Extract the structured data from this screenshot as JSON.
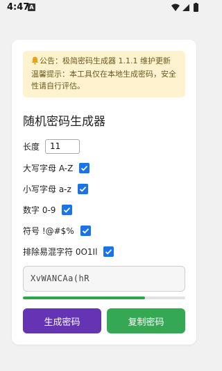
{
  "statusbar": {
    "time": "4:47",
    "app_badge": "A",
    "icons": [
      "wifi-icon",
      "cellular-icon",
      "battery-icon"
    ]
  },
  "notice": {
    "icon": "bell-icon",
    "text": "公告：极简密码生成器 1.1.1 维护更新 温馨提示：本工具仅在本地生成密码，安全性请自行评估。",
    "bg_color": "#fff3cf"
  },
  "generator": {
    "title": "随机密码生成器",
    "length_label": "长度",
    "length_value": "11",
    "options": [
      {
        "label": "大写字母 A-Z",
        "checked": true
      },
      {
        "label": "小写字母 a-z",
        "checked": true
      },
      {
        "label": "数字 0-9",
        "checked": true
      },
      {
        "label": "符号 !@#$%",
        "checked": true
      },
      {
        "label": "排除易混字符 0O1Il",
        "checked": true
      }
    ],
    "password": "XvWANCAa(hR",
    "strength_percent": 75,
    "strength_color": "#2aa849",
    "generate_label": "生成密码",
    "copy_label": "复制密码",
    "generate_color": "#6534b5",
    "copy_color": "#34a853",
    "checkbox_color": "#1a73e8"
  }
}
